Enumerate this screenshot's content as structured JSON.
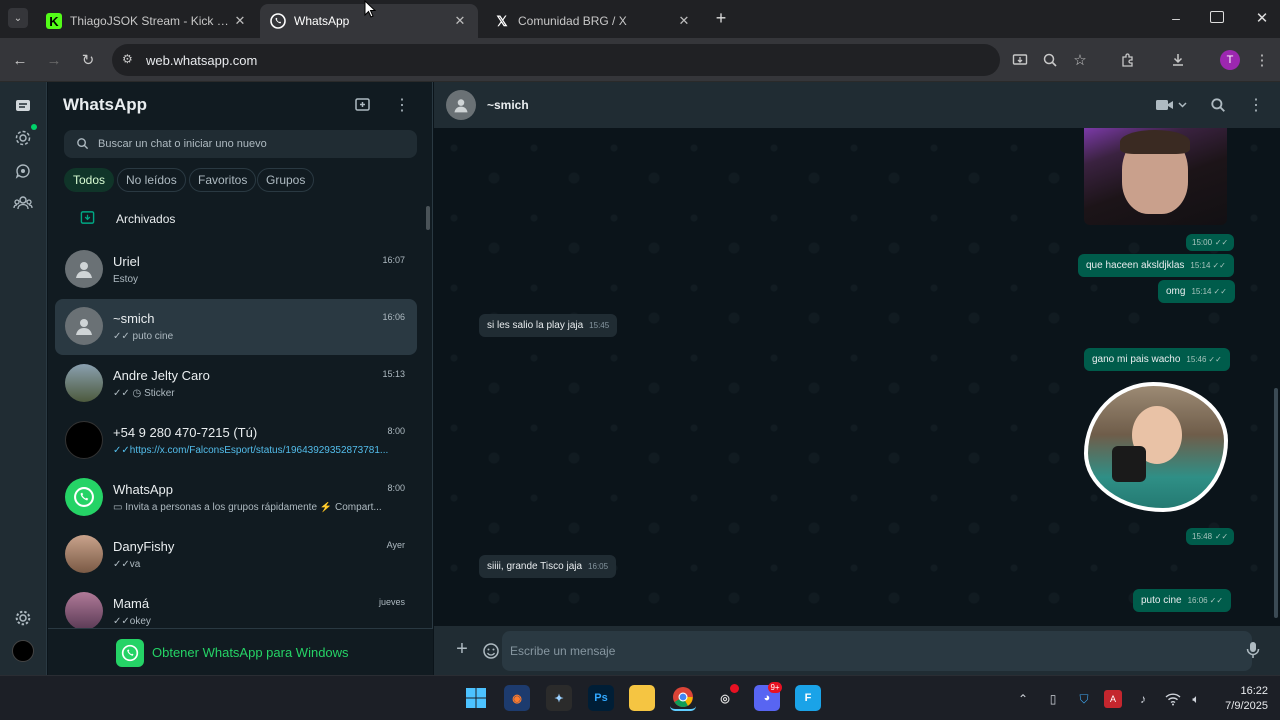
{
  "browser": {
    "tabs": [
      {
        "title": "ThiagoJSOK Stream - Kick Dash",
        "icon": "kick-icon",
        "color": "#53fc18"
      },
      {
        "title": "WhatsApp",
        "icon": "whatsapp-icon",
        "color": "#25d366"
      },
      {
        "title": "Comunidad BRG / X",
        "icon": "x-icon",
        "color": "#ffffff"
      }
    ],
    "url": "web.whatsapp.com",
    "profile_initial": "T"
  },
  "sidebar": {
    "title": "WhatsApp",
    "search_placeholder": "Buscar un chat o iniciar uno nuevo",
    "filters": [
      "Todos",
      "No leídos",
      "Favoritos",
      "Grupos"
    ],
    "archived_label": "Archivados",
    "chats": [
      {
        "name": "Uriel",
        "time": "16:07",
        "preview": "Estoy"
      },
      {
        "name": "~smich",
        "time": "16:06",
        "preview": "puto cine"
      },
      {
        "name": "Andre Jelty Caro",
        "time": "15:13",
        "preview": "Sticker"
      },
      {
        "name": "+54 9 280 470-7215 (Tú)",
        "time": "8:00",
        "preview": "https://x.com/FalconsEsport/status/19643929352873781..."
      },
      {
        "name": "WhatsApp",
        "time": "8:00",
        "preview": "Invita a personas a los grupos rápidamente ⚡ Compart..."
      },
      {
        "name": "DanyFishy",
        "time": "Ayer",
        "preview": "va"
      },
      {
        "name": "Mamá",
        "time": "jueves",
        "preview": "okey"
      }
    ],
    "promo": "Obtener WhatsApp para Windows"
  },
  "conversation": {
    "contact": "~smich",
    "messages": [
      {
        "dir": "out",
        "kind": "image",
        "time": "15:00"
      },
      {
        "dir": "out",
        "text": "que haceen aksldjklas",
        "time": "15:14"
      },
      {
        "dir": "out",
        "text": "omg",
        "time": "15:14"
      },
      {
        "dir": "in",
        "text": "si les salio la play jaja",
        "time": "15:45"
      },
      {
        "dir": "out",
        "text": "gano mi pais wacho",
        "time": "15:46"
      },
      {
        "dir": "out",
        "kind": "sticker",
        "time": "15:48"
      },
      {
        "dir": "in",
        "text": "siiii, grande Tisco jaja",
        "time": "16:05"
      },
      {
        "dir": "out",
        "text": "puto cine",
        "time": "16:06"
      }
    ],
    "composer_placeholder": "Escribe un mensaje"
  },
  "taskbar": {
    "time": "16:22",
    "date": "7/9/2025",
    "discord_badge": "9+"
  },
  "colors": {
    "accent": "#00a884",
    "outgoing": "#005c4b",
    "incoming": "#202c33",
    "panel": "#111b21"
  }
}
